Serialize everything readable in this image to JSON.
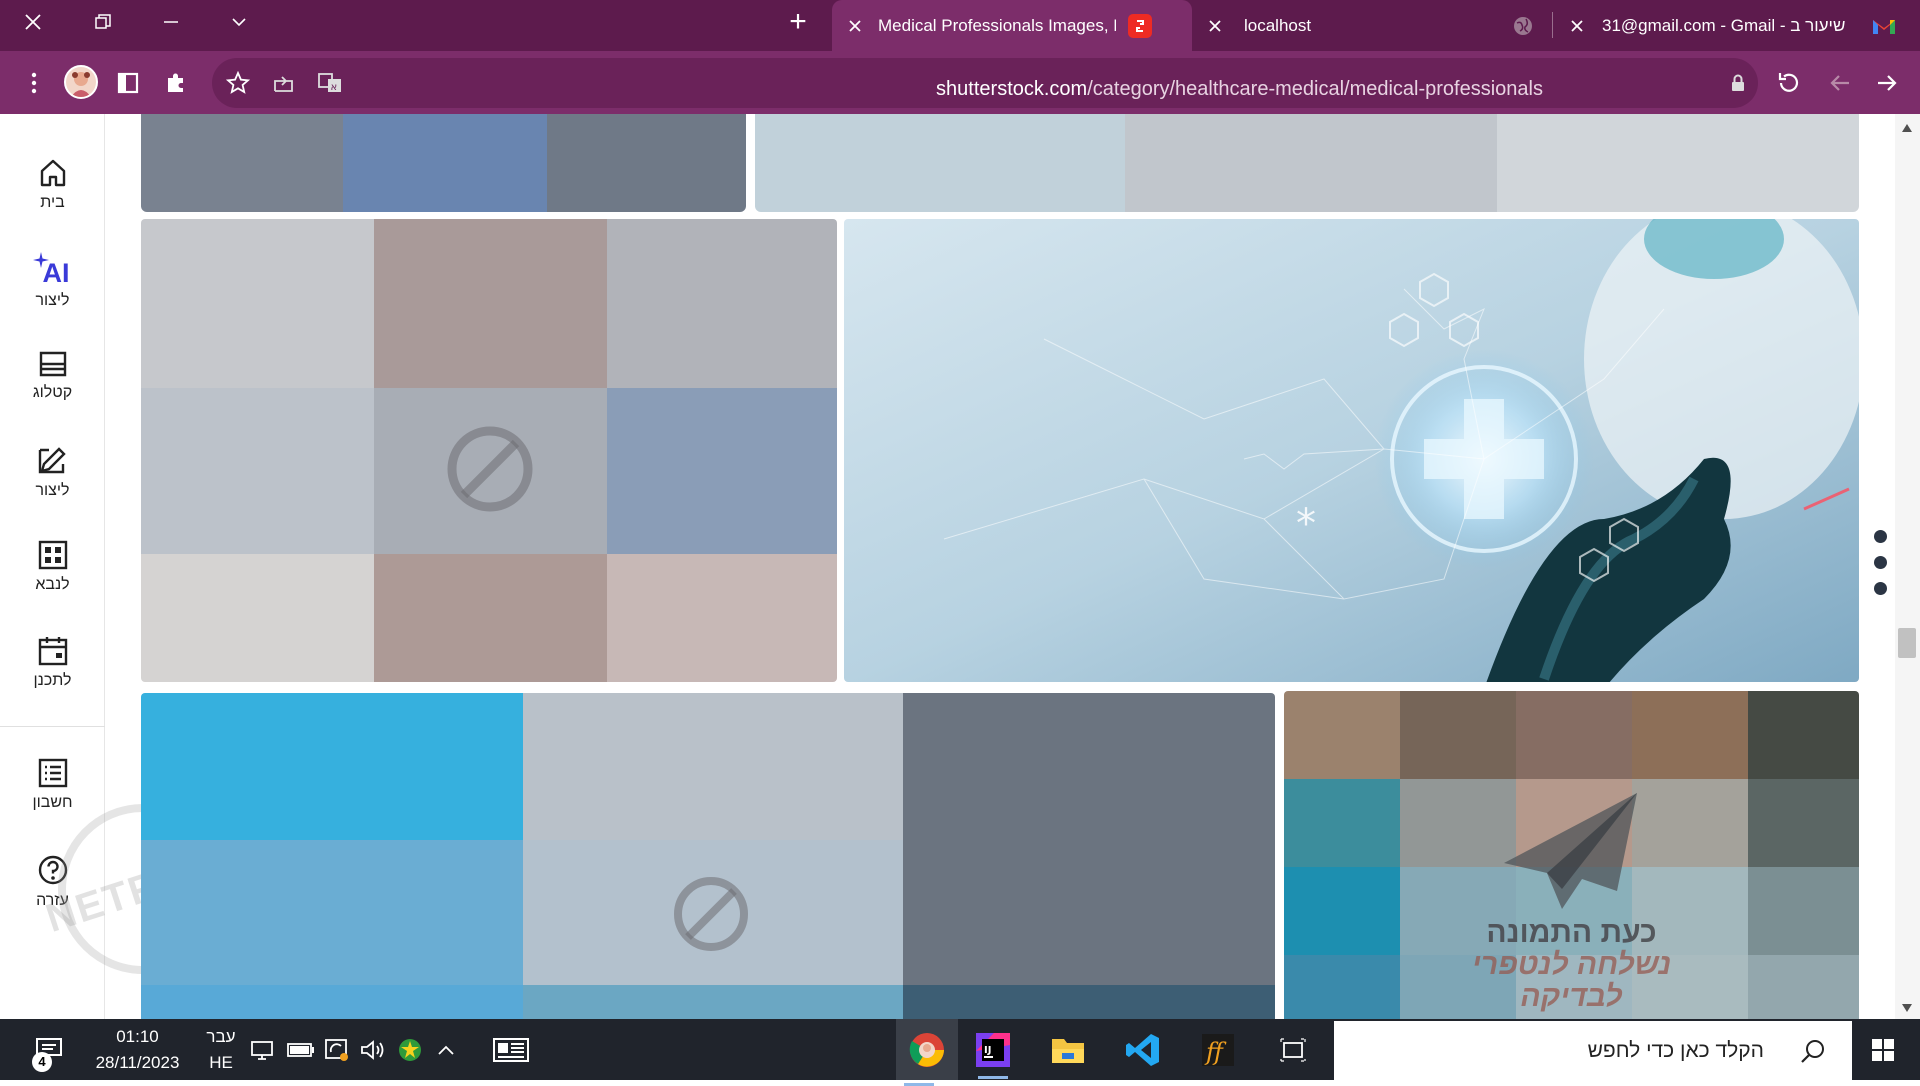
{
  "browser": {
    "tabs": [
      {
        "title": "Medical Professionals Images, Pi",
        "active": true
      },
      {
        "title": "localhost",
        "active": false
      },
      {
        "title": "31@gmail.com - Gmail - שיעור ב",
        "active": false
      }
    ],
    "new_tab_label": "+",
    "url_host": "shutterstock.com",
    "url_path": "/category/healthcare-medical/medical-professionals"
  },
  "sidebar": {
    "items": [
      {
        "label": "בית",
        "icon": "home-icon"
      },
      {
        "label": "ליצור",
        "icon": "ai-sparkle-icon",
        "icon_text": "AI"
      },
      {
        "label": "קטלוג",
        "icon": "catalog-icon"
      },
      {
        "label": "ליצור",
        "icon": "edit-icon"
      },
      {
        "label": "לנבא",
        "icon": "grid-icon"
      },
      {
        "label": "לתכנן",
        "icon": "calendar-icon"
      },
      {
        "label": "חשבון",
        "icon": "list-icon"
      },
      {
        "label": "עזרה",
        "icon": "help-icon"
      }
    ],
    "watermark_text": "NETFREE"
  },
  "content": {
    "blocked_notice_line1": "כעת התמונה",
    "blocked_notice_line2": "נשלחה לנטפרי",
    "blocked_notice_line3": "לבדיקה"
  },
  "taskbar": {
    "search_placeholder": "הקלד כאן כדי לחפש",
    "time": "01:10",
    "date": "28/11/2023",
    "lang_top": "עבר",
    "lang_bottom": "HE",
    "notification_count": "4"
  },
  "colors": {
    "tabbar": "#5d1b4d",
    "toolbar": "#7c2d6a",
    "taskbar": "#20242c"
  }
}
